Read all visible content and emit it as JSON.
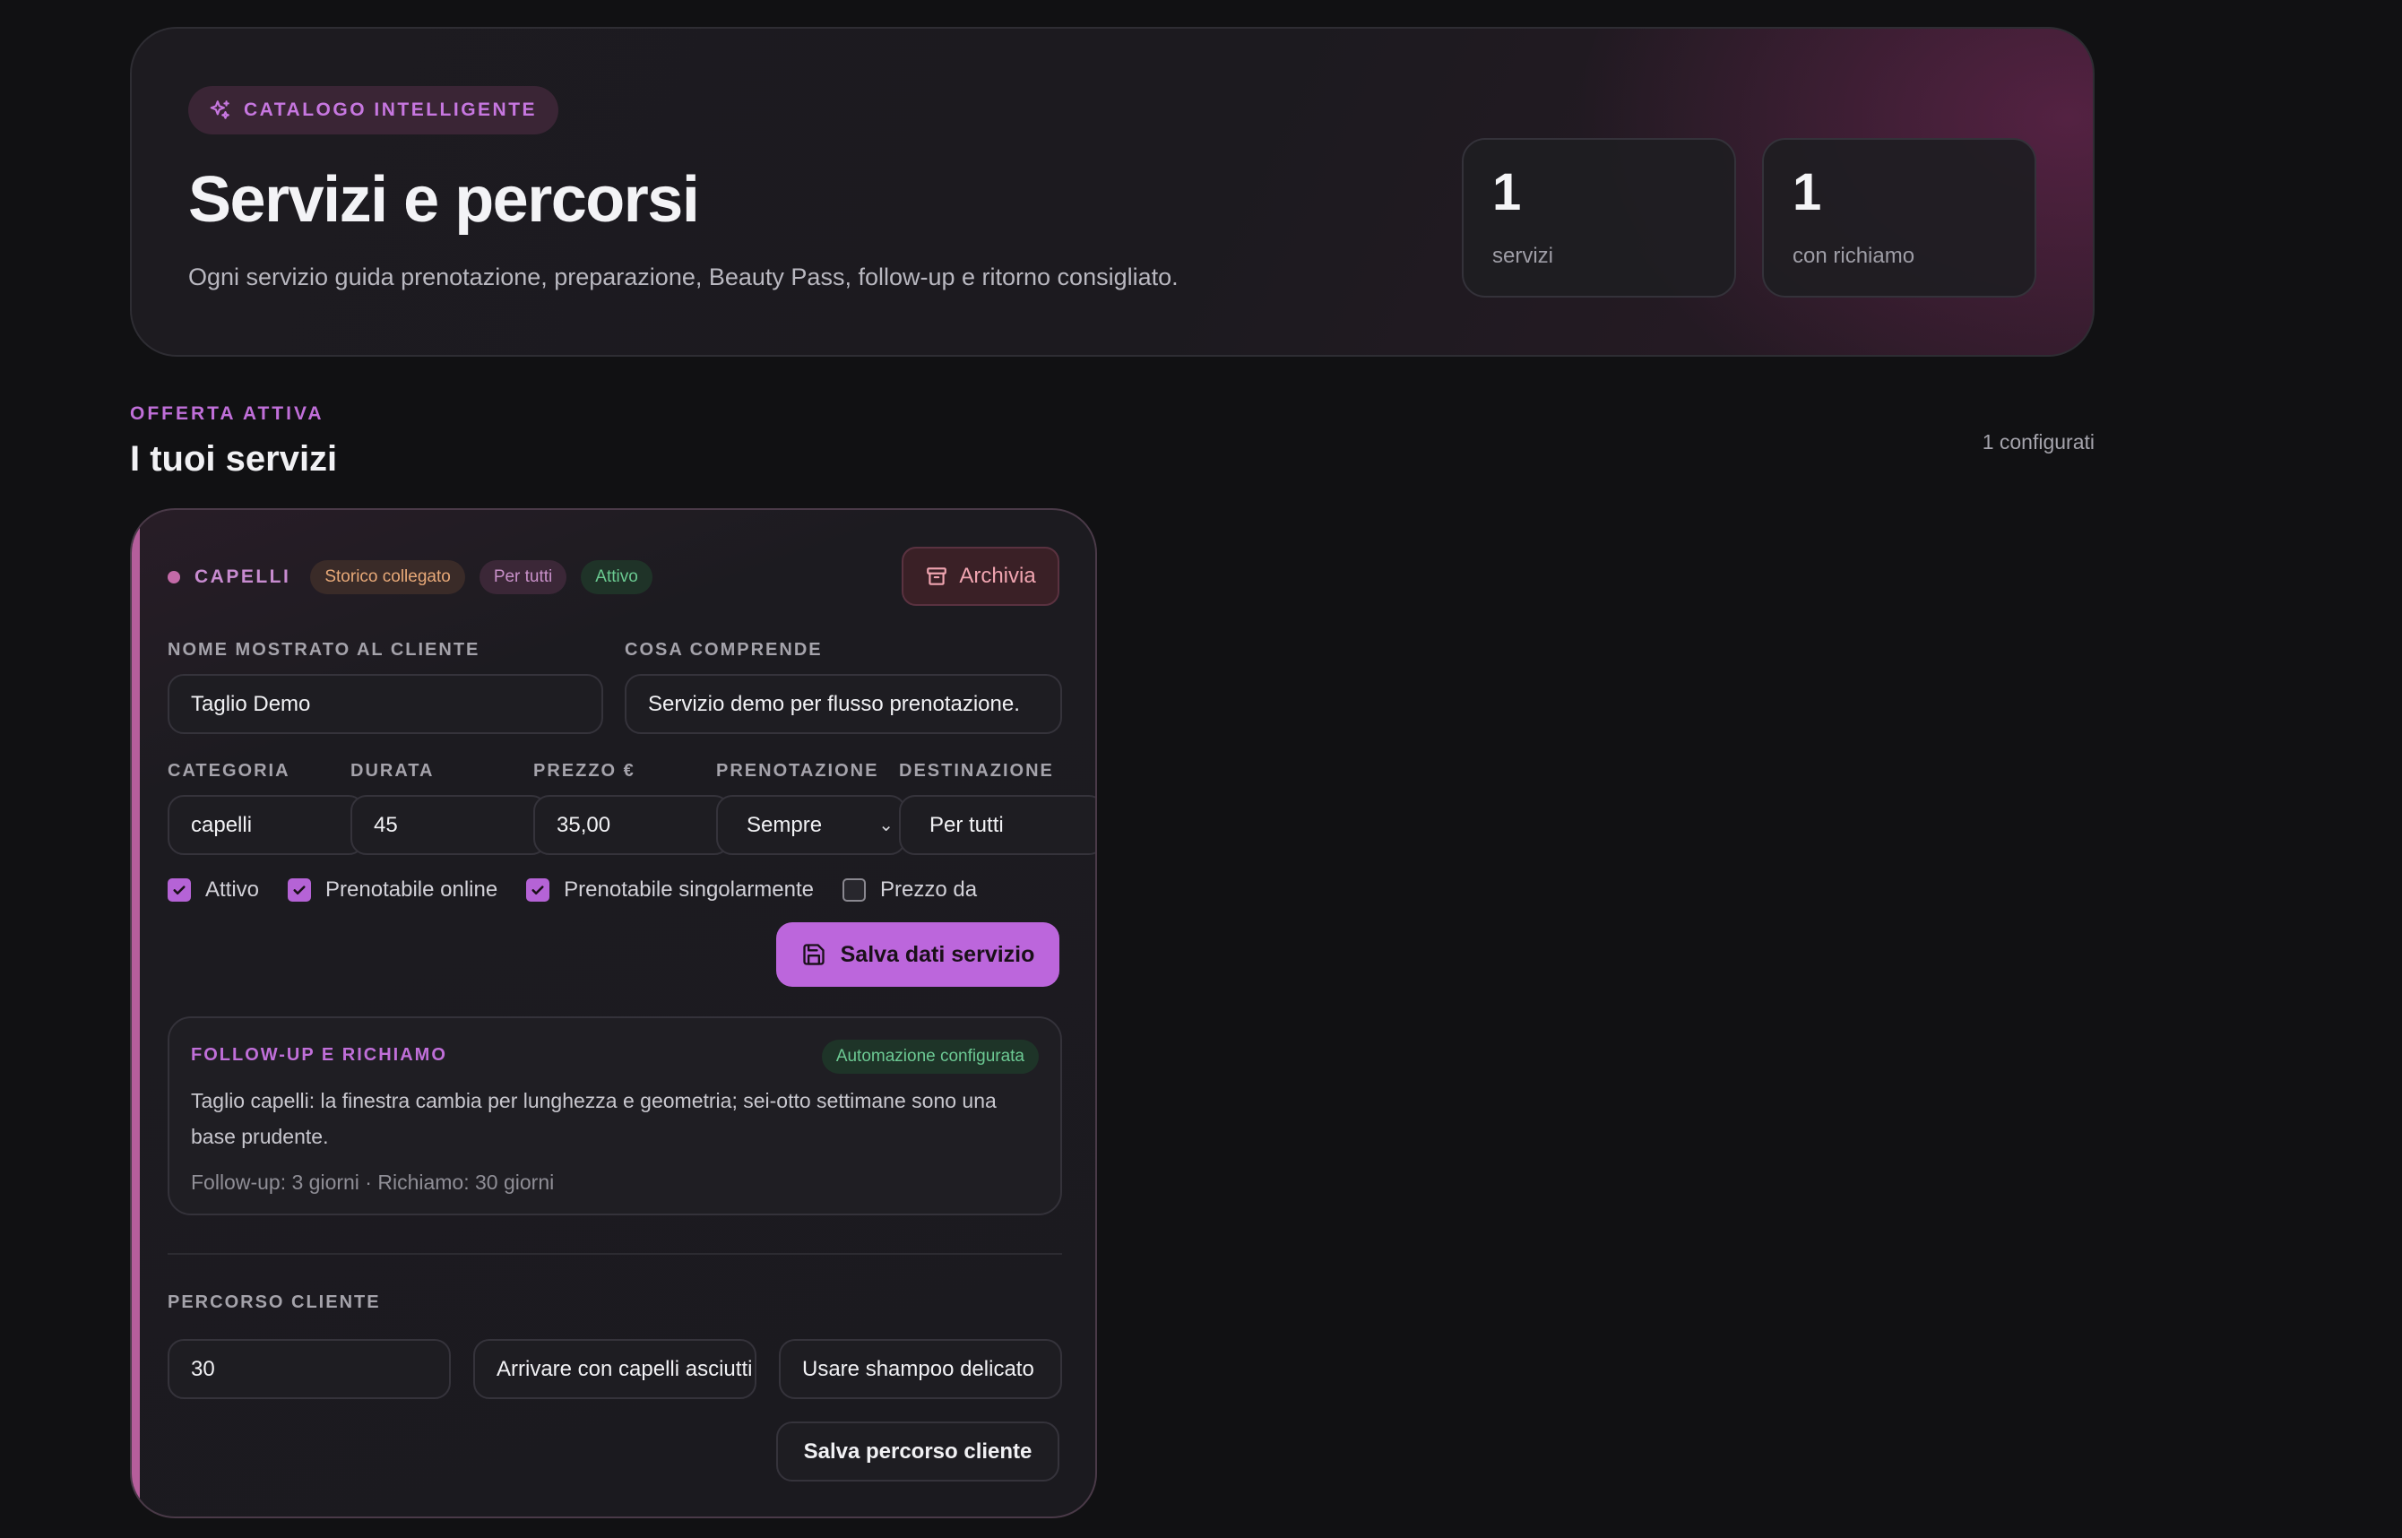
{
  "hero": {
    "badge": "CATALOGO INTELLIGENTE",
    "title": "Servizi e percorsi",
    "subtitle": "Ogni servizio guida prenotazione, preparazione, Beauty Pass, follow-up e ritorno consigliato.",
    "stats": [
      {
        "value": "1",
        "label": "servizi"
      },
      {
        "value": "1",
        "label": "con richiamo"
      }
    ]
  },
  "section": {
    "eyebrow": "OFFERTA ATTIVA",
    "title": "I tuoi servizi",
    "count": "1 configurati"
  },
  "card": {
    "category": "CAPELLI",
    "tags": [
      "Storico collegato",
      "Per tutti",
      "Attivo"
    ],
    "archive_label": "Archivia",
    "fields": {
      "name_label": "NOME MOSTRATO AL CLIENTE",
      "name_value": "Taglio Demo",
      "includes_label": "COSA COMPRENDE",
      "includes_value": "Servizio demo per flusso prenotazione.",
      "category_label": "CATEGORIA",
      "category_value": "capelli",
      "duration_label": "DURATA",
      "duration_value": "45",
      "price_label": "PREZZO €",
      "price_value": "35,00",
      "booking_label": "PRENOTAZIONE",
      "booking_value": "Sempre",
      "destination_label": "DESTINAZIONE",
      "destination_value": "Per tutti"
    },
    "checkboxes": [
      {
        "label": "Attivo",
        "checked": true
      },
      {
        "label": "Prenotabile online",
        "checked": true
      },
      {
        "label": "Prenotabile singolarmente",
        "checked": true
      },
      {
        "label": "Prezzo da",
        "checked": false
      }
    ],
    "save_label": "Salva dati servizio",
    "followup": {
      "title": "FOLLOW-UP E RICHIAMO",
      "badge": "Automazione configurata",
      "text": "Taglio capelli: la finestra cambia per lunghezza e geometria; sei-otto settimane sono una base prudente.",
      "meta": "Follow-up: 3 giorni · Richiamo: 30 giorni"
    },
    "journey": {
      "title": "PERCORSO CLIENTE",
      "inputs": [
        "30",
        "Arrivare con capelli asciutti",
        "Usare shampoo delicato"
      ],
      "save_label": "Salva percorso cliente"
    }
  },
  "colors": {
    "accent": "#bc66dc",
    "background": "#111113",
    "category_dot": "#c46aa8"
  }
}
